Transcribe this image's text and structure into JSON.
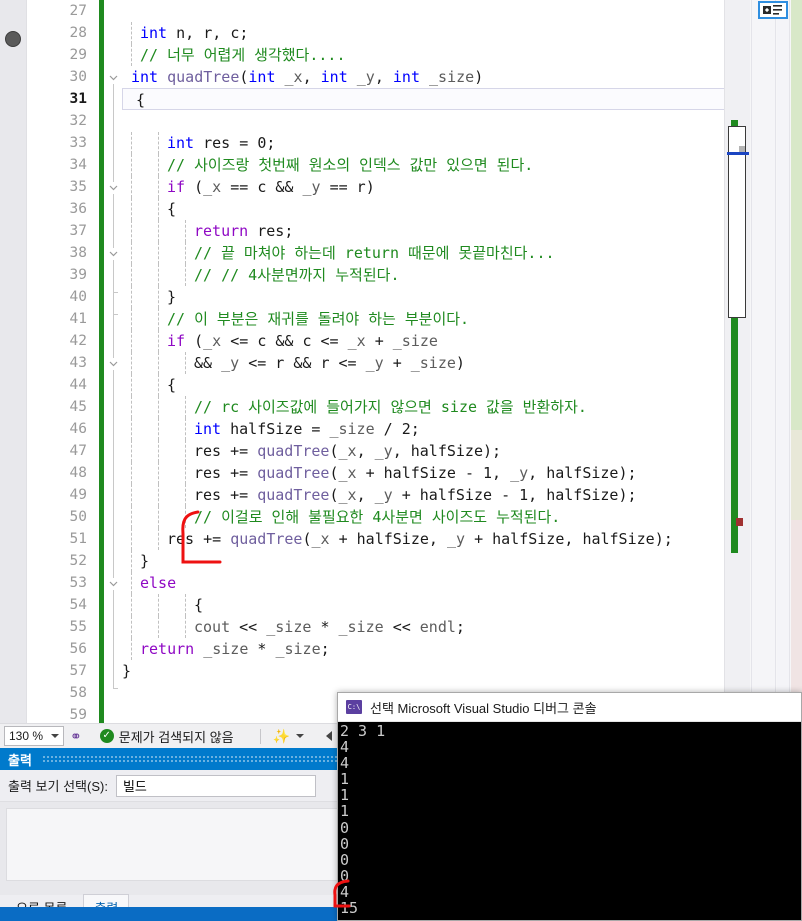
{
  "editor": {
    "first_line": 27,
    "current_line": 31,
    "breakpoint_line": 28,
    "lines": [
      {
        "n": 27,
        "text": ""
      },
      {
        "n": 28,
        "text": "int n, r, c;"
      },
      {
        "n": 29,
        "text": "// 너무 어렵게 생각했다...."
      },
      {
        "n": 30,
        "text": "int quadTree(int _x, int _y, int _size)"
      },
      {
        "n": 31,
        "text": "{"
      },
      {
        "n": 32,
        "text": ""
      },
      {
        "n": 33,
        "text": "int res = 0;"
      },
      {
        "n": 34,
        "text": "// 사이즈랑 첫번째 원소의 인덱스 값만 있으면 된다."
      },
      {
        "n": 35,
        "text": "if (_x == c && _y == r)"
      },
      {
        "n": 36,
        "text": "{"
      },
      {
        "n": 37,
        "text": "return res;"
      },
      {
        "n": 38,
        "text": "// 끝 마쳐야 하는데 return 때문에 못끝마친다..."
      },
      {
        "n": 39,
        "text": "// // 4사분면까지 누적된다."
      },
      {
        "n": 40,
        "text": "}"
      },
      {
        "n": 41,
        "text": "// 이 부분은 재귀를 돌려야 하는 부분이다."
      },
      {
        "n": 42,
        "text": "if (_x <= c && c <= _x + _size"
      },
      {
        "n": 43,
        "text": "&& _y <= r && r <= _y + _size)"
      },
      {
        "n": 44,
        "text": "{"
      },
      {
        "n": 45,
        "text": "// rc 사이즈값에 들어가지 않으면 size 값을 반환하자."
      },
      {
        "n": 46,
        "text": "int halfSize = _size / 2;"
      },
      {
        "n": 47,
        "text": "res += quadTree(_x, _y, halfSize);"
      },
      {
        "n": 48,
        "text": "res += quadTree(_x + halfSize - 1, _y, halfSize);"
      },
      {
        "n": 49,
        "text": "res += quadTree(_x, _y + halfSize - 1, halfSize);"
      },
      {
        "n": 50,
        "text": "// 이걸로 인해 불필요한 4사분면 사이즈도 누적된다."
      },
      {
        "n": 51,
        "text": "res += quadTree(_x + halfSize, _y + halfSize, halfSize);"
      },
      {
        "n": 52,
        "text": "}"
      },
      {
        "n": 53,
        "text": "else"
      },
      {
        "n": 54,
        "text": "{"
      },
      {
        "n": 55,
        "text": "cout << _size * _size << endl;"
      },
      {
        "n": 56,
        "text": "return _size * _size;"
      },
      {
        "n": 57,
        "text": "}"
      },
      {
        "n": 58,
        "text": ""
      },
      {
        "n": 59,
        "text": ""
      }
    ]
  },
  "status_bar": {
    "zoom_level": "130 %",
    "problems_text": "문제가 검색되지 않음",
    "ok_glyph": "✓",
    "nav_icon": "navigate-backward-icon",
    "broom_icon": "code-cleanup-icon"
  },
  "output_window": {
    "title": "출력",
    "view_label": "출력 보기 선택(S):",
    "view_value": "빌드",
    "body_text": "",
    "tabs": [
      {
        "label": "오류 목록",
        "active": false
      },
      {
        "label": "출력",
        "active": true
      }
    ]
  },
  "console_window": {
    "title": "선택 Microsoft Visual Studio 디버그 콘솔",
    "icon": "console-icon",
    "icon_glyph": "C:\\",
    "lines": [
      "2 3 1",
      "4",
      "4",
      "1",
      "1",
      "1",
      "0",
      "0",
      "0",
      "0",
      "4",
      "15"
    ]
  },
  "right_panel": {
    "top_button_icon": "add-to-list-icon"
  },
  "annotations": {
    "color": "#ee1111",
    "code_bracket": "bracket-around-line-50-51",
    "console_bracket": "bracket-around-value-4"
  },
  "colors": {
    "accent_blue": "#007acc",
    "keyword_blue": "#0000ff",
    "control_purple": "#8f08c4",
    "comment_green": "#1f8a1f",
    "function_purple": "#6f5f9e",
    "changebar_green": "#1f8a1f",
    "annotation_red": "#ee1111",
    "taskbar_blue": "#0a6cc4"
  }
}
